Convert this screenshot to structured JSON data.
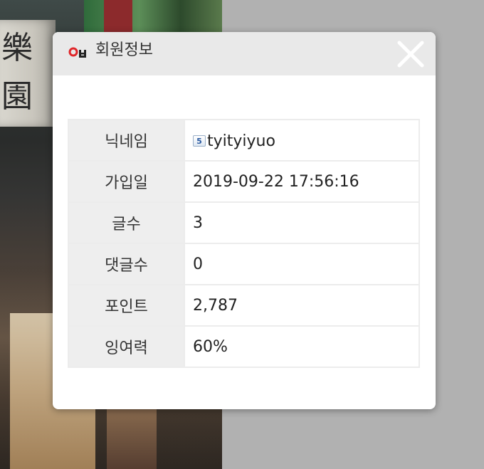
{
  "modal": {
    "title": "회원정보",
    "close_icon": "close-icon"
  },
  "member": {
    "rows": [
      {
        "label": "닉네임",
        "value": "tyityiyuo",
        "icon": "level-badge-icon",
        "icon_text": "5"
      },
      {
        "label": "가입일",
        "value": "2019-09-22 17:56:16"
      },
      {
        "label": "글수",
        "value": "3"
      },
      {
        "label": "댓글수",
        "value": "0"
      },
      {
        "label": "포인트",
        "value": "2,787"
      },
      {
        "label": "잉여력",
        "value": "60%"
      }
    ]
  },
  "background": {
    "sign_glyphs": [
      "樂",
      "園"
    ]
  },
  "colors": {
    "header_bg": "#e9e9e9",
    "label_bg": "#eeeeee",
    "border": "#ececec",
    "page_bg": "#b1b1b1"
  }
}
